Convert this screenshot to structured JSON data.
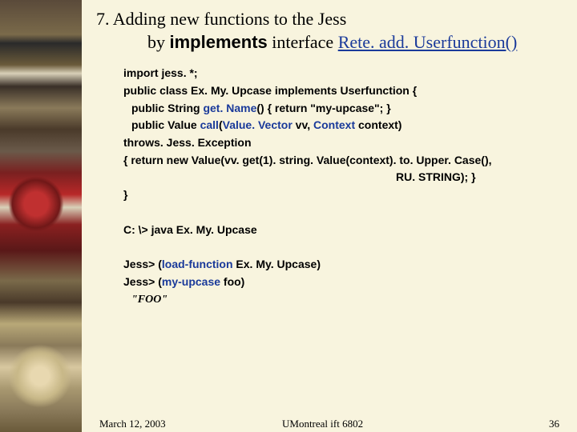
{
  "heading": {
    "line1": "7. Adding new functions to the Jess",
    "by": "by ",
    "implements": "implements",
    "interface": " interface ",
    "retelink": "Rete. add. Userfunction()"
  },
  "code": {
    "l1": "import jess. *;",
    "l2": "public class Ex. My. Upcase implements Userfunction {",
    "l3a": "public String ",
    "l3_getname": "get. Name",
    "l3b": "() { return \"my-upcase\"; }",
    "l4a": "public Value ",
    "l4_call": "call",
    "l4_p1": "(",
    "l4_vv": "Value. Vector",
    "l4_mid": " vv, ",
    "l4_ctx": "Context",
    "l4_end": " context)",
    "l5": "throws. Jess. Exception",
    "l6": "{ return new Value(vv. get(1). string. Value(context). to. Upper. Case(),",
    "l7": "RU. STRING); }",
    "l8": "}",
    "cmd": "C: \\> java Ex. My. Upcase",
    "j1a": "Jess> (",
    "j1_lf": "load-function",
    "j1b": " Ex. My. Upcase)",
    "j2a": "Jess> (",
    "j2_mu": "my-upcase",
    "j2b": " foo)",
    "out": "\"FOO\""
  },
  "footer": {
    "date": "March 12, 2003",
    "center": "UMontreal ift 6802",
    "page": "36"
  }
}
